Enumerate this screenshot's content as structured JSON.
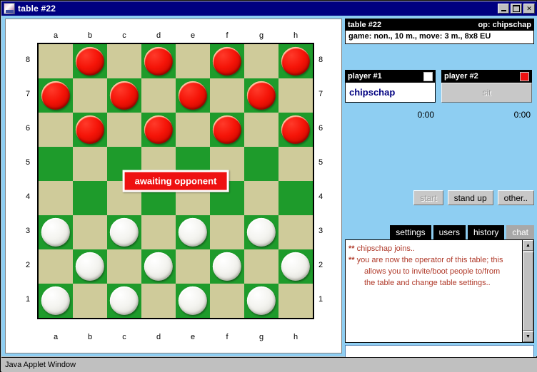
{
  "window": {
    "title": "table #22",
    "icon": "app-icon",
    "buttons": {
      "minimize": "_",
      "maximize": "□",
      "close": "✕"
    }
  },
  "statusbar": {
    "text": "Java Applet Window"
  },
  "board": {
    "files": [
      "a",
      "b",
      "c",
      "d",
      "e",
      "f",
      "g",
      "h"
    ],
    "ranks": [
      "8",
      "7",
      "6",
      "5",
      "4",
      "3",
      "2",
      "1"
    ],
    "light_color": "#cfcb9a",
    "dark_color": "#1e9b2b",
    "overlay_message": "awaiting opponent",
    "rows": [
      [
        null,
        "red",
        null,
        "red",
        null,
        "red",
        null,
        "red"
      ],
      [
        "red",
        null,
        "red",
        null,
        "red",
        null,
        "red",
        null
      ],
      [
        null,
        "red",
        null,
        "red",
        null,
        "red",
        null,
        "red"
      ],
      [
        null,
        null,
        null,
        null,
        null,
        null,
        null,
        null
      ],
      [
        null,
        null,
        null,
        null,
        null,
        null,
        null,
        null
      ],
      [
        "white",
        null,
        "white",
        null,
        "white",
        null,
        "white",
        null
      ],
      [
        null,
        "white",
        null,
        "white",
        null,
        "white",
        null,
        "white"
      ],
      [
        "white",
        null,
        "white",
        null,
        "white",
        null,
        "white",
        null
      ]
    ]
  },
  "table_info": {
    "name": "table #22",
    "operator": "op: chipschap",
    "game_line": "game: non., 10 m., move: 3 m., 8x8 EU"
  },
  "players": [
    {
      "header": "player #1",
      "color_swatch": "#ffffff",
      "name": "chipschap",
      "seated": true,
      "clock": "0:00"
    },
    {
      "header": "player #2",
      "color_swatch": "#ee1111",
      "sit_label": "sit",
      "seated": false,
      "clock": "0:00"
    }
  ],
  "actions": [
    {
      "label": "start",
      "enabled": false
    },
    {
      "label": "stand up",
      "enabled": true
    },
    {
      "label": "other..",
      "enabled": true
    }
  ],
  "tabs": [
    {
      "label": "settings",
      "active": false
    },
    {
      "label": "users",
      "active": false
    },
    {
      "label": "history",
      "active": false
    },
    {
      "label": "chat",
      "active": true
    }
  ],
  "chat": {
    "text_color": "#b03a2a",
    "lines": [
      {
        "stars": "**",
        "text": "chipschap joins..",
        "indent": false
      },
      {
        "stars": "**",
        "text": "you are now the operator of this table; this",
        "indent": false
      },
      {
        "stars": "",
        "text": "allows you to invite/boot people to/from",
        "indent": true
      },
      {
        "stars": "",
        "text": "the table and change table settings..",
        "indent": true
      }
    ],
    "input_value": "",
    "scrollbar": {
      "up": "▲",
      "down": "▼"
    }
  }
}
